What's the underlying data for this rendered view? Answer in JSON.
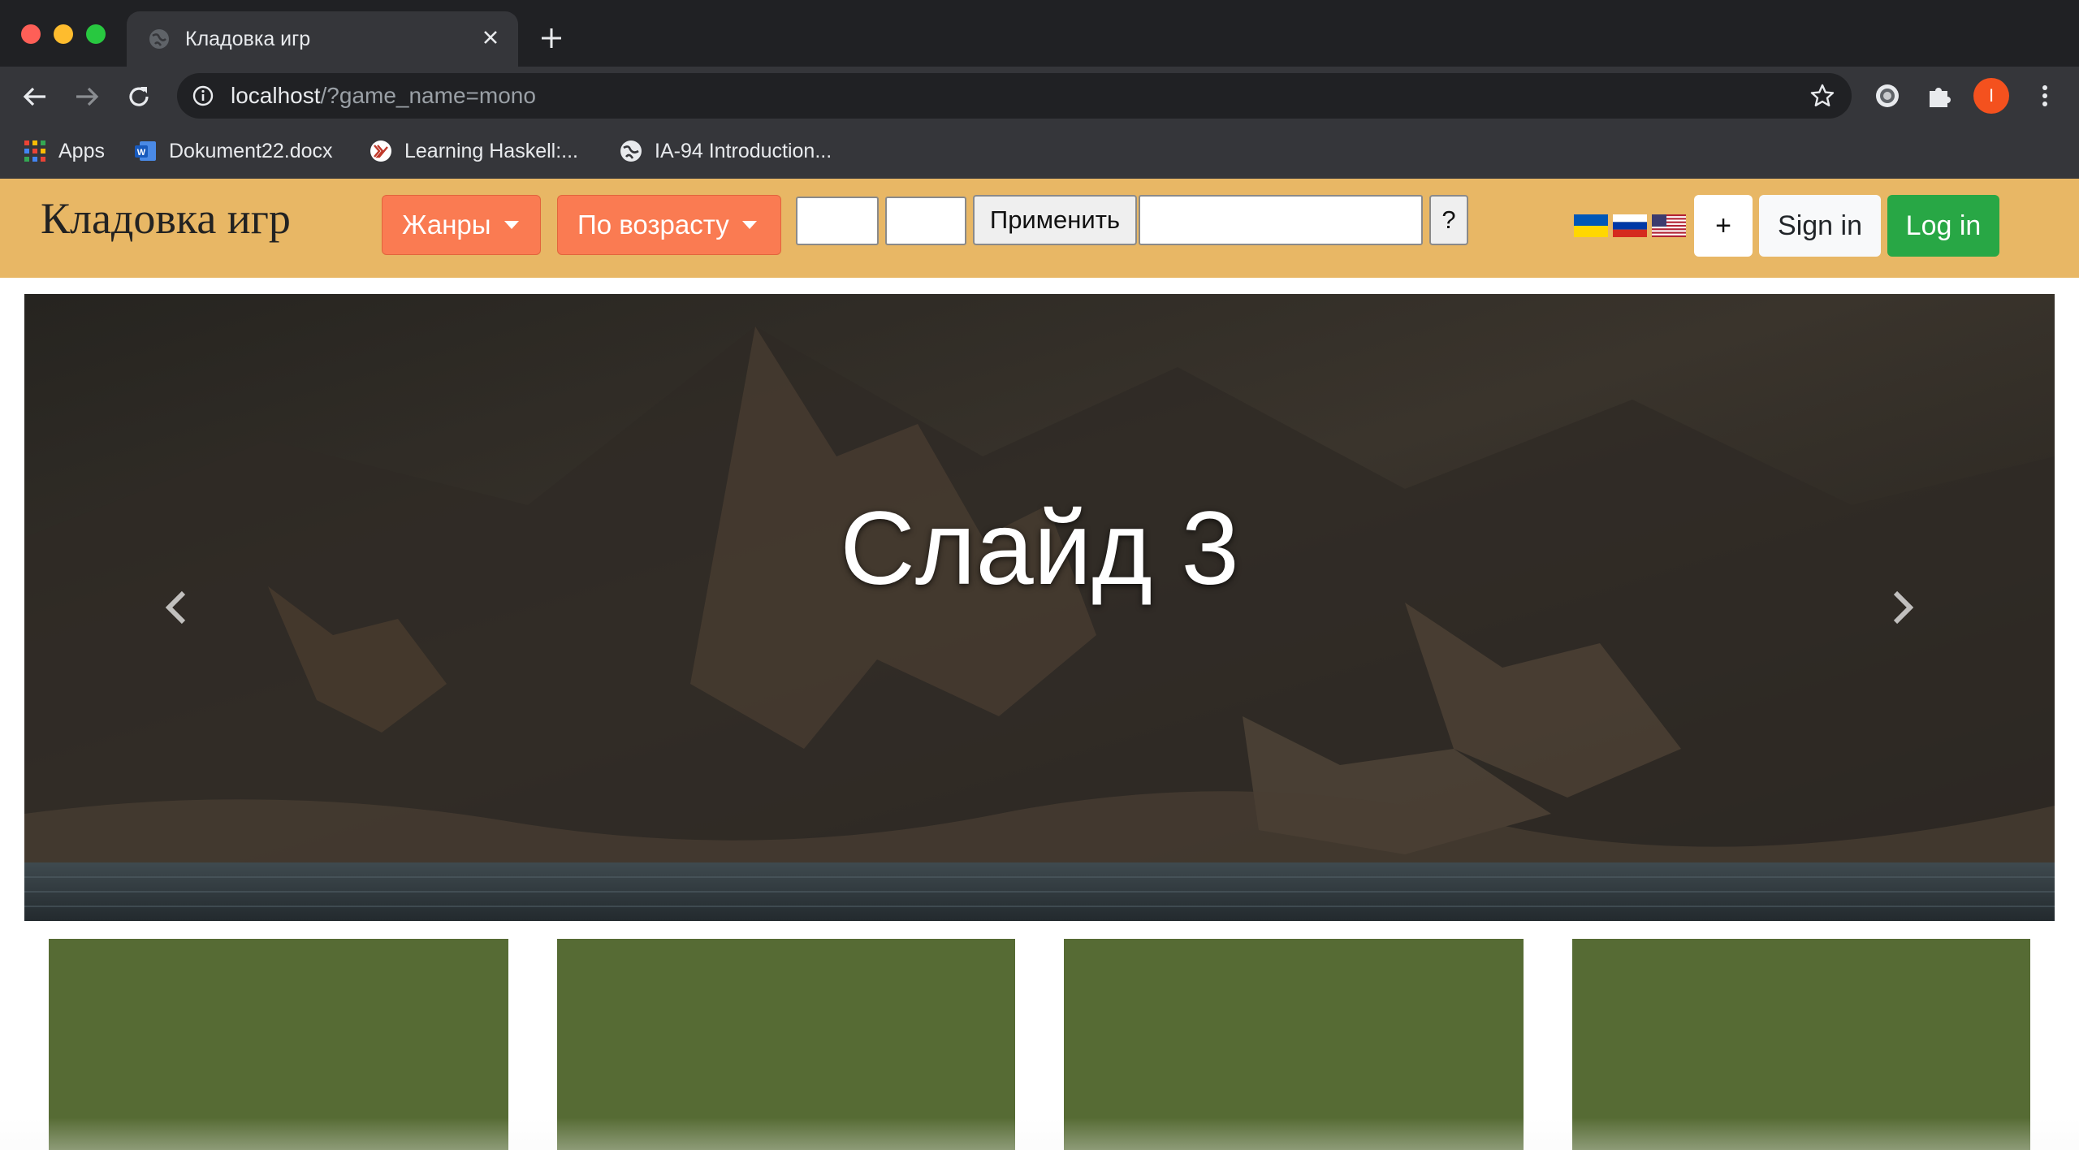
{
  "browser": {
    "tab_title": "Кладовка игр",
    "url_host": "localhost",
    "url_path": "/?game_name=mono",
    "profile_initial": "I",
    "bookmarks": [
      {
        "label": "Apps",
        "icon": "apps-grid-icon"
      },
      {
        "label": "Dokument22.docx",
        "icon": "word-doc-icon"
      },
      {
        "label": "Learning Haskell:...",
        "icon": "haskell-icon"
      },
      {
        "label": "IA-94 Introduction...",
        "icon": "globe-icon"
      }
    ]
  },
  "site": {
    "brand": "Кладовка игр",
    "genres_label": "Жанры",
    "age_label": "По возрасту",
    "age_from_value": "",
    "age_to_value": "",
    "apply_label": "Применить",
    "search_value": "",
    "help_label": "?",
    "languages": [
      "ua",
      "ru",
      "us"
    ],
    "add_label": "+",
    "signin_label": "Sign in",
    "login_label": "Log in",
    "colors": {
      "navbar": "#e8b765",
      "dropdown": "#fa7b52",
      "login": "#28a745",
      "card": "#566b34"
    }
  },
  "carousel": {
    "caption": "Слайд 3"
  },
  "cards": [
    {
      "id": "card-1"
    },
    {
      "id": "card-2"
    },
    {
      "id": "card-3"
    },
    {
      "id": "card-4"
    }
  ]
}
